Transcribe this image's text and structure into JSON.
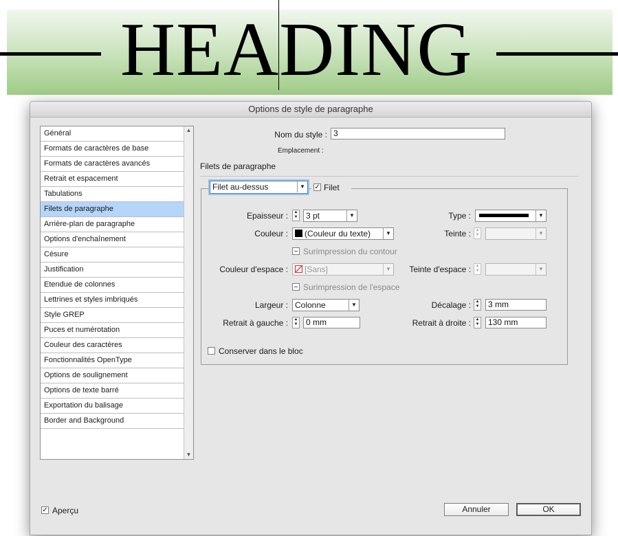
{
  "document": {
    "heading": "HEADING"
  },
  "dialog": {
    "title": "Options de style de paragraphe",
    "sidebar": {
      "items": [
        "Général",
        "Formats de caractères de base",
        "Formats de caractères avancés",
        "Retrait et espacement",
        "Tabulations",
        "Filets de paragraphe",
        "Arrière-plan de paragraphe",
        "Options d'enchaînement",
        "Césure",
        "Justification",
        "Etendue de colonnes",
        "Lettrines et styles imbriqués",
        "Style GREP",
        "Puces et numérotation",
        "Couleur des caractères",
        "Fonctionnalités OpenType",
        "Options de soulignement",
        "Options de texte barré",
        "Exportation du balisage",
        "Border and Background"
      ],
      "selected": "Filets de paragraphe"
    },
    "style_name_label": "Nom du style :",
    "style_name_value": "3",
    "location_label": "Emplacement :",
    "section_title": "Filets de paragraphe",
    "rule_position": "Filet au-dessus",
    "rule_checkbox_label": "Filet",
    "rule_checked": true,
    "fields": {
      "epaisseur_label": "Epaisseur :",
      "epaisseur_value": "3 pt",
      "type_label": "Type :",
      "couleur_label": "Couleur :",
      "couleur_value": "(Couleur du texte)",
      "teinte_label": "Teinte :",
      "surimpression_contour": "Surimpression du contour",
      "couleur_espace_label": "Couleur d'espace :",
      "couleur_espace_value": "[Sans]",
      "teinte_espace_label": "Teinte d'espace :",
      "surimpression_espace": "Surimpression de l'espace",
      "largeur_label": "Largeur :",
      "largeur_value": "Colonne",
      "decalage_label": "Décalage :",
      "decalage_value": "3 mm",
      "retrait_gauche_label": "Retrait à gauche :",
      "retrait_gauche_value": "0 mm",
      "retrait_droite_label": "Retrait à droite :",
      "retrait_droite_value": "130 mm",
      "conserver_label": "Conserver dans le bloc"
    },
    "preview_label": "Aperçu",
    "preview_checked": true,
    "cancel_label": "Annuler",
    "ok_label": "OK"
  }
}
